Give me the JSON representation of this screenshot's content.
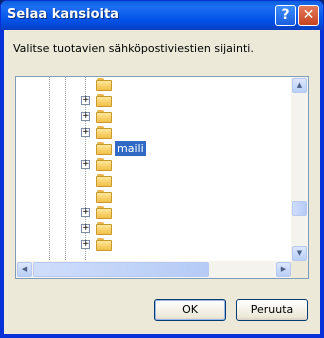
{
  "window": {
    "title": "Selaa kansioita",
    "help_icon": "help-icon",
    "close_icon": "close-icon"
  },
  "description": "Valitse tuotavien sähköpostiviestien sijainti.",
  "tree": {
    "rows": [
      {
        "expander": "",
        "label": ""
      },
      {
        "expander": "+",
        "label": ""
      },
      {
        "expander": "+",
        "label": ""
      },
      {
        "expander": "+",
        "label": ""
      },
      {
        "expander": "",
        "label": "maili",
        "selected": true
      },
      {
        "expander": "+",
        "label": ""
      },
      {
        "expander": "",
        "label": ""
      },
      {
        "expander": "",
        "label": ""
      },
      {
        "expander": "+",
        "label": ""
      },
      {
        "expander": "+",
        "label": ""
      },
      {
        "expander": "+",
        "label": ""
      }
    ]
  },
  "buttons": {
    "ok": "OK",
    "cancel": "Peruuta"
  }
}
